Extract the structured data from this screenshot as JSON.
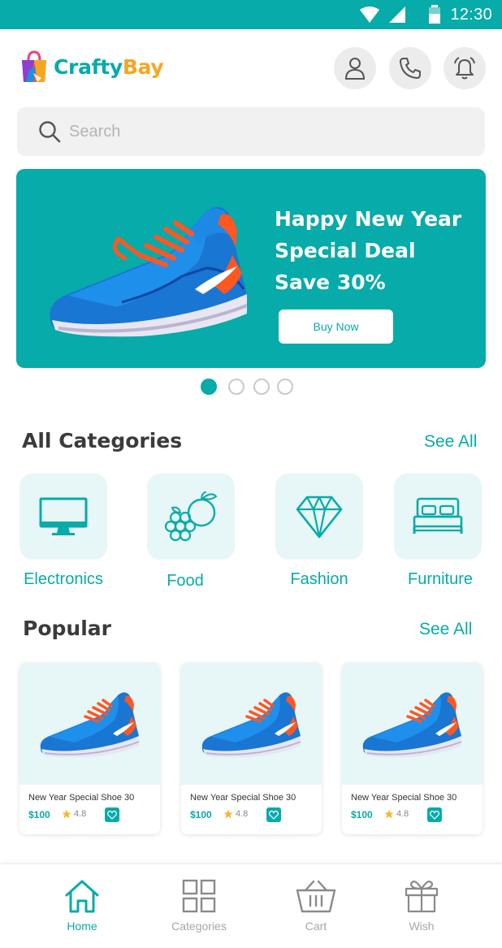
{
  "status_bar": {
    "time": "12:30",
    "icons": [
      "wifi-icon",
      "signal-icon",
      "battery-icon"
    ]
  },
  "brand": {
    "name_part1": "Crafty",
    "name_part2": "Bay",
    "color_primary": "#07ABA9",
    "color_secondary": "#F5A623"
  },
  "header": {
    "actions": [
      "user-icon",
      "phone-icon",
      "bell-icon"
    ]
  },
  "search": {
    "placeholder": "Search",
    "value": ""
  },
  "banner": {
    "line1": "Happy New Year",
    "line2": "Special Deal",
    "line3": "Save 30%",
    "button_label": "Buy Now",
    "background": "#07ABA9"
  },
  "carousel": {
    "total": 4,
    "active_index": 0
  },
  "categories": {
    "title": "All Categories",
    "see_all": "See All",
    "items": [
      {
        "label": "Electronics",
        "icon": "monitor-icon"
      },
      {
        "label": "Food",
        "icon": "fruits-icon"
      },
      {
        "label": "Fashion",
        "icon": "diamond-icon"
      },
      {
        "label": "Furniture",
        "icon": "bed-icon"
      }
    ]
  },
  "popular": {
    "title": "Popular",
    "see_all": "See All",
    "products": [
      {
        "name": "New Year Special Shoe 30",
        "price": "$100",
        "rating": "4.8"
      },
      {
        "name": "New Year Special Shoe 30",
        "price": "$100",
        "rating": "4.8"
      },
      {
        "name": "New Year Special Shoe 30",
        "price": "$100",
        "rating": "4.8"
      }
    ]
  },
  "bottom_nav": {
    "active": "Home",
    "items": [
      {
        "label": "Home",
        "icon": "home-icon"
      },
      {
        "label": "Categories",
        "icon": "grid-icon"
      },
      {
        "label": "Cart",
        "icon": "basket-icon"
      },
      {
        "label": "Wish",
        "icon": "gift-icon"
      }
    ]
  }
}
